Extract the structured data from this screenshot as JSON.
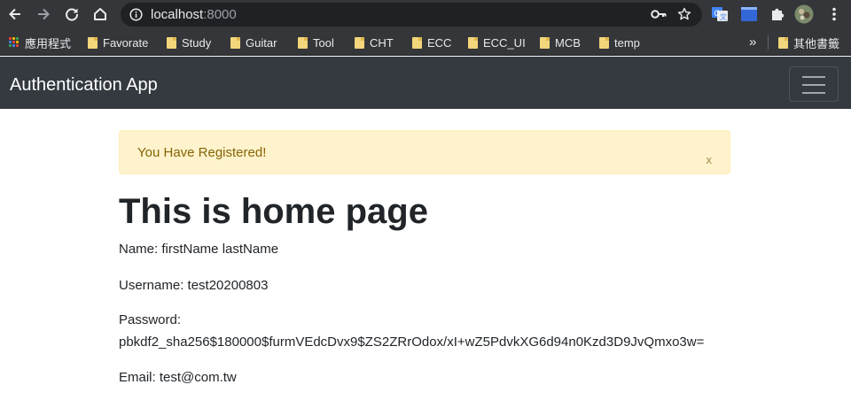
{
  "browser": {
    "url_host": "localhost",
    "url_port": ":8000",
    "bookmarks": {
      "apps": "應用程式",
      "items": [
        "Favorate",
        "Study",
        "Guitar",
        "Tool",
        "CHT",
        "ECC",
        "ECC_UI",
        "MCB",
        "temp"
      ],
      "more": "»",
      "other": "其他書籤"
    }
  },
  "navbar": {
    "brand": "Authentication App"
  },
  "alert": {
    "message": "You Have Registered!",
    "close": "x"
  },
  "page": {
    "heading": "This is home page",
    "name": "Name: firstName lastName",
    "username": "Username: test20200803",
    "password_label": "Password:",
    "password_hash": "pbkdf2_sha256$180000$furmVEdcDvx9$ZS2ZRrOdox/xI+wZ5PdvkXG6d94n0Kzd3D9JvQmxo3w=",
    "email": "Email: test@com.tw"
  }
}
